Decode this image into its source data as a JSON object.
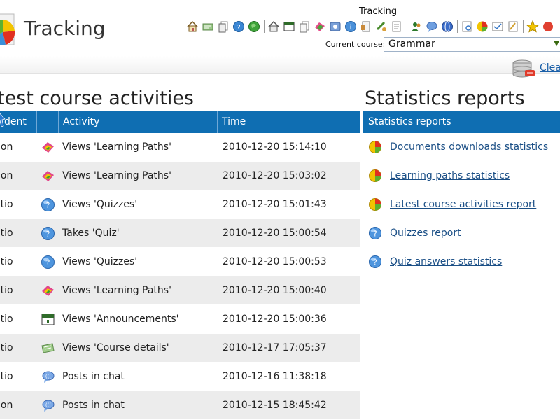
{
  "header": {
    "app_title": "Tracking",
    "toolbar_label": "Tracking",
    "current_course_label": "Current course:",
    "current_course_value": "Grammar",
    "clear_label": "Clea"
  },
  "activities": {
    "title": "test course activities",
    "columns": [
      "dent",
      "",
      "Activity",
      "Time"
    ],
    "rows": [
      {
        "student": "non",
        "icon": "learning-path-icon",
        "activity": "Views 'Learning Paths'",
        "time": "2010-12-20 15:14:10"
      },
      {
        "student": "non",
        "icon": "learning-path-icon",
        "activity": "Views 'Learning Paths'",
        "time": "2010-12-20 15:03:02"
      },
      {
        "student": "atio",
        "icon": "quiz-icon",
        "activity": "Views 'Quizzes'",
        "time": "2010-12-20 15:01:43"
      },
      {
        "student": "atio",
        "icon": "quiz-icon",
        "activity": "Takes 'Quiz'",
        "time": "2010-12-20 15:00:54"
      },
      {
        "student": "atio",
        "icon": "quiz-icon",
        "activity": "Views 'Quizzes'",
        "time": "2010-12-20 15:00:53"
      },
      {
        "student": "atio",
        "icon": "learning-path-icon",
        "activity": "Views 'Learning Paths'",
        "time": "2010-12-20 15:00:40"
      },
      {
        "student": "atio",
        "icon": "announcement-icon",
        "activity": "Views 'Announcements'",
        "time": "2010-12-20 15:00:36"
      },
      {
        "student": "atio",
        "icon": "course-details-icon",
        "activity": "Views 'Course details'",
        "time": "2010-12-17 17:05:37"
      },
      {
        "student": "atio",
        "icon": "chat-icon",
        "activity": "Posts in chat",
        "time": "2010-12-16 11:38:18"
      },
      {
        "student": "non",
        "icon": "chat-icon",
        "activity": "Posts in chat",
        "time": "2010-12-15 18:45:42"
      }
    ]
  },
  "stats": {
    "title": "Statistics reports",
    "header": "Statistics reports",
    "items": [
      {
        "label": "Documents downloads statistics",
        "icon": "pie-chart-icon"
      },
      {
        "label": "Learning paths statistics",
        "icon": "pie-chart-icon"
      },
      {
        "label": "Latest course activities report",
        "icon": "pie-chart-icon"
      },
      {
        "label": "Quizzes report",
        "icon": "quiz-icon"
      },
      {
        "label": "Quiz answers statistics",
        "icon": "quiz-icon"
      }
    ]
  },
  "colors": {
    "table_header": "#0f6eb2",
    "link": "#1b4f86",
    "row_alt": "#ececec"
  }
}
